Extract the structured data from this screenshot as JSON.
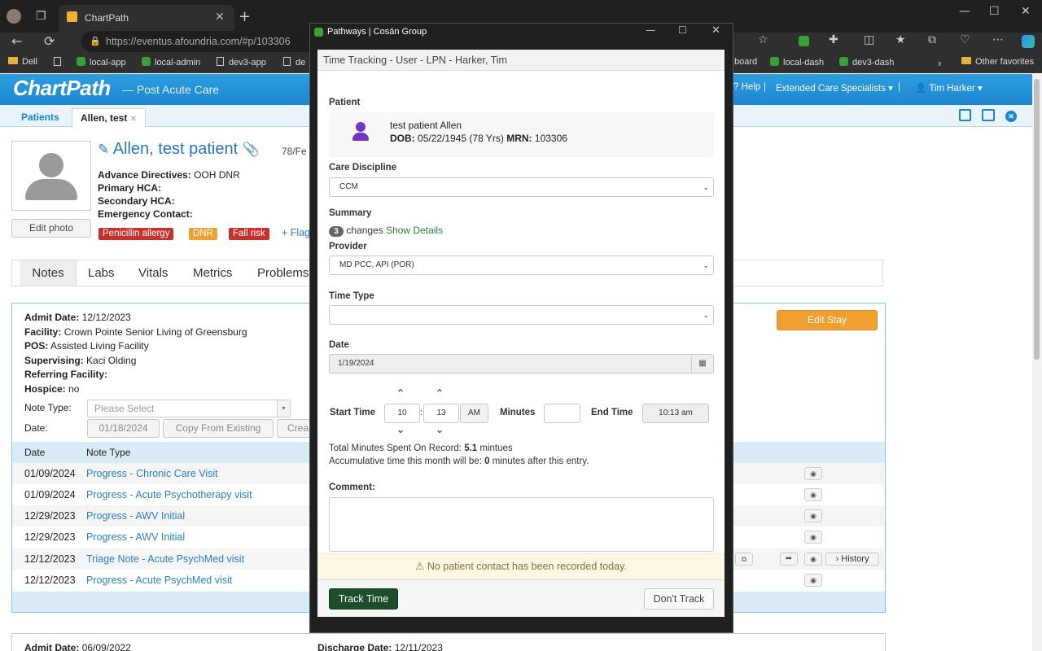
{
  "browser": {
    "tab_title": "ChartPath",
    "url": "https://eventus.afoundria.com/#p/103306",
    "bookmarks": [
      {
        "label": "Dell",
        "kind": "folder"
      },
      {
        "label": "",
        "kind": "page"
      },
      {
        "label": "local-app",
        "kind": "green"
      },
      {
        "label": "local-admin",
        "kind": "green"
      },
      {
        "label": "dev3-app",
        "kind": "page"
      },
      {
        "label": "de",
        "kind": "page"
      }
    ],
    "bookmarks_right": [
      {
        "label": "board"
      },
      {
        "label": "local-dash"
      },
      {
        "label": "dev3-dash"
      }
    ],
    "other_favorites": "Other favorites"
  },
  "app": {
    "logo": "ChartPath",
    "logo_sub": "Post Acute Care",
    "help": "Help",
    "org": "Extended Care Specialists",
    "user": "Tim Harker",
    "tabs": [
      "Patients",
      "Allen, test"
    ]
  },
  "patient": {
    "name": "Allen, test patient",
    "age_sex": "78/Fe",
    "edit_photo": "Edit photo",
    "advance_directives_label": "Advance Directives:",
    "advance_directives": "OOH DNR",
    "primary_hca_label": "Primary HCA:",
    "secondary_hca_label": "Secondary HCA:",
    "emergency_contact_label": "Emergency Contact:",
    "badges": [
      {
        "label": "Penicillin allergy",
        "color": "#c9302c"
      },
      {
        "label": "DNR",
        "color": "#f0a030"
      },
      {
        "label": "Fall risk",
        "color": "#c9302c"
      }
    ],
    "flag": "Flag"
  },
  "section_tabs": [
    "Notes",
    "Labs",
    "Vitals",
    "Metrics",
    "Problems"
  ],
  "stay": {
    "admit_date_label": "Admit Date:",
    "admit_date": "12/12/2023",
    "facility_label": "Facility:",
    "facility": "Crown Pointe Senior Living of Greensburg",
    "pos_label": "POS:",
    "pos": "Assisted Living Facility",
    "supervising_label": "Supervising:",
    "supervising": "Kaci Olding",
    "referring_label": "Referring Facility:",
    "hospice_label": "Hospice:",
    "hospice": "no",
    "note_type_label": "Note Type:",
    "note_type_placeholder": "Please Select",
    "date_label": "Date:",
    "date_value": "01/18/2024",
    "copy_btn": "Copy From Existing",
    "create_btn": "Crea",
    "edit_stay": "Edit Stay",
    "col_date": "Date",
    "col_type": "Note Type",
    "history": "History",
    "notes": [
      {
        "date": "01/09/2024",
        "type": "Progress - Chronic Care Visit"
      },
      {
        "date": "01/09/2024",
        "type": "Progress - Acute Psychotherapy visit"
      },
      {
        "date": "12/29/2023",
        "type": "Progress - AWV Initial"
      },
      {
        "date": "12/29/2023",
        "type": "Progress - AWV Initial"
      },
      {
        "date": "12/12/2023",
        "type": "Triage Note - Acute PsychMed visit"
      },
      {
        "date": "12/12/2023",
        "type": "Progress - Acute PsychMed visit"
      }
    ]
  },
  "prev_stay": {
    "admit_date_label": "Admit Date:",
    "admit_date": "06/09/2022",
    "discharge_label": "Discharge Date:",
    "discharge_date": "12/11/2023"
  },
  "modal": {
    "window_title": "Pathways | Cosán Group",
    "header": "Time Tracking - User - LPN - Harker, Tim",
    "patient_label": "Patient",
    "patient_name": "test patient Allen",
    "dob_label": "DOB:",
    "dob": "05/22/1945 (78 Yrs)",
    "mrn_label": "MRN:",
    "mrn": "103306",
    "care_discipline_label": "Care Discipline",
    "care_discipline": "CCM",
    "summary_label": "Summary",
    "changes_count": "3",
    "changes_text": "changes",
    "show_details": "Show Details",
    "provider_label": "Provider",
    "provider": "MD PCC, API (POR)",
    "time_type_label": "Time Type",
    "time_type": "",
    "date_label": "Date",
    "date": "1/19/2024",
    "start_time_label": "Start Time",
    "start_hour": "10",
    "start_min": "13",
    "ampm": "AM",
    "minutes_label": "Minutes",
    "minutes": "",
    "end_time_label": "End Time",
    "end_time": "10:13 am",
    "total_label": "Total Minutes Spent On Record:",
    "total_value": "5.1",
    "total_unit": "mintues",
    "accum_prefix": "Accumulative time this month will be:",
    "accum_value": "0",
    "accum_suffix": "minutes after this entry.",
    "comment_label": "Comment:",
    "warning": "No patient contact has been recorded today.",
    "track_btn": "Track Time",
    "dont_track_btn": "Don't Track"
  },
  "colors": {
    "brand": "#1a86cf",
    "accent_orange": "#f0a030",
    "track_green": "#1e4d2b"
  }
}
